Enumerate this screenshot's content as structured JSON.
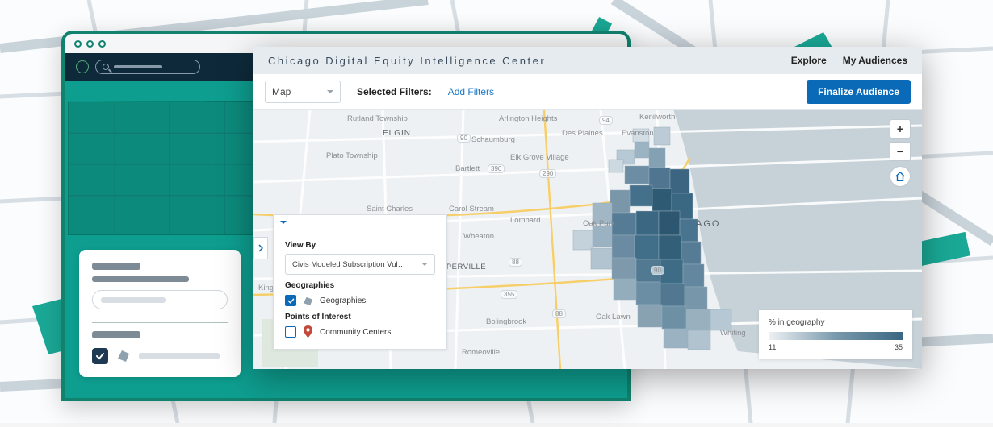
{
  "app": {
    "title": "Chicago Digital Equity Intelligence Center",
    "nav": {
      "explore": "Explore",
      "audiences": "My Audiences"
    }
  },
  "filter_bar": {
    "view_select": "Map",
    "selected_label": "Selected Filters:",
    "add_filters": "Add Filters",
    "finalize": "Finalize Audience"
  },
  "control_panel": {
    "view_by_label": "View By",
    "view_by_value": "Civis Modeled Subscription Vul…",
    "geographies_label": "Geographies",
    "geographies_option": "Geographies",
    "poi_label": "Points of Interest",
    "poi_option": "Community Centers"
  },
  "legend": {
    "title": "% in geography",
    "min": "11",
    "max": "35"
  },
  "zoom": {
    "in": "+",
    "out": "−"
  },
  "map_labels": {
    "elgin": "ELGIN",
    "rutland": "Rutland Township",
    "plato": "Plato Township",
    "stcharles": "Saint Charles",
    "naperville": "APERVILLE",
    "kingston": "Kingston",
    "schaumburg": "Schaumburg",
    "arlington": "Arlington Heights",
    "desplaines": "Des Plaines",
    "elkgrove": "Elk Grove Village",
    "bartlett": "Bartlett",
    "wheaton": "Wheaton",
    "carol": "Carol Stream",
    "lombard": "Lombard",
    "bolingbrook": "Bolingbrook",
    "romeoville": "Romeoville",
    "oakpark": "Oak Park",
    "oaklawn": "Oak Lawn",
    "evanston": "Evanston",
    "kenilworth": "Kenilworth",
    "whiting": "Whiting",
    "chicago": "AGO",
    "r390": "390",
    "r290": "290",
    "r90a": "90",
    "r90b": "90",
    "r88a": "88",
    "r88b": "88",
    "r355": "355",
    "r94": "94"
  }
}
